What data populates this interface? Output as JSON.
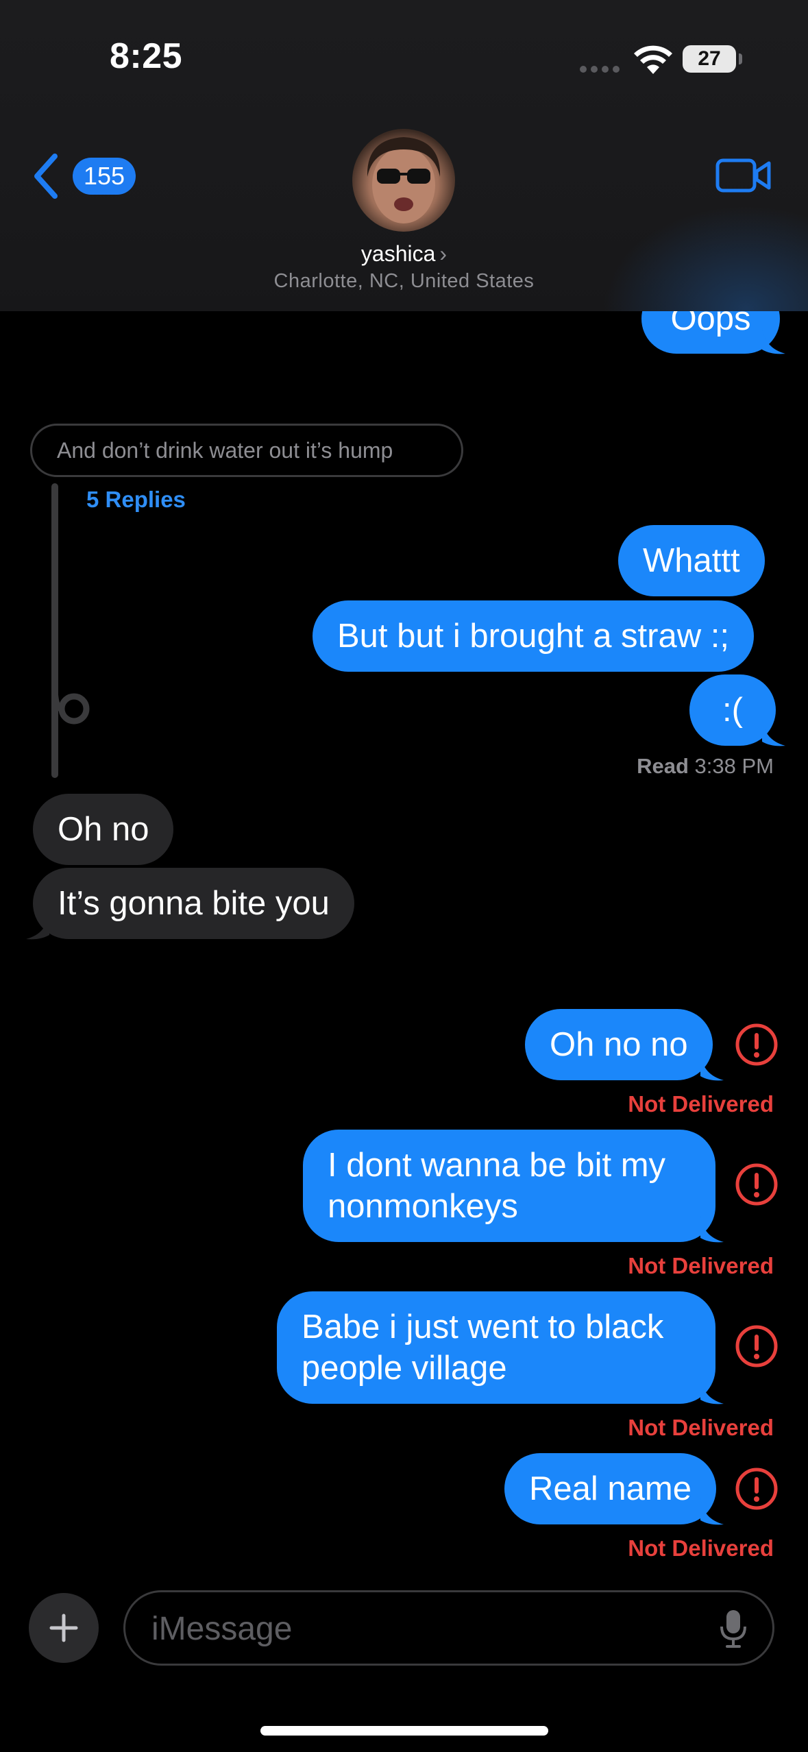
{
  "status_bar": {
    "time": "8:25",
    "battery": "27"
  },
  "header": {
    "back_count": "155",
    "contact_name": "yashica",
    "contact_location": "Charlotte, NC, United States"
  },
  "messages": {
    "top_partial": "Oops",
    "reply_quote": "And don’t drink water out it’s hump",
    "reply_count": "5 Replies",
    "m1": "Whattt",
    "m2": "But but i brought a straw :;",
    "m3": ":(",
    "read_label": "Read",
    "read_time": "3:38 PM",
    "r1": "Oh no",
    "r2": "It’s gonna bite you",
    "s1": "Oh no no",
    "s2": "I dont wanna be bit my nonmonkeys",
    "s3": "Babe i just went to black people village",
    "s4": "Real name",
    "not_delivered": "Not Delivered"
  },
  "input": {
    "placeholder": "iMessage"
  },
  "colors": {
    "sent_bubble": "#1b87fa",
    "received_bubble": "#262628",
    "error_red": "#e8403c",
    "accent_blue": "#1e7cf2"
  }
}
